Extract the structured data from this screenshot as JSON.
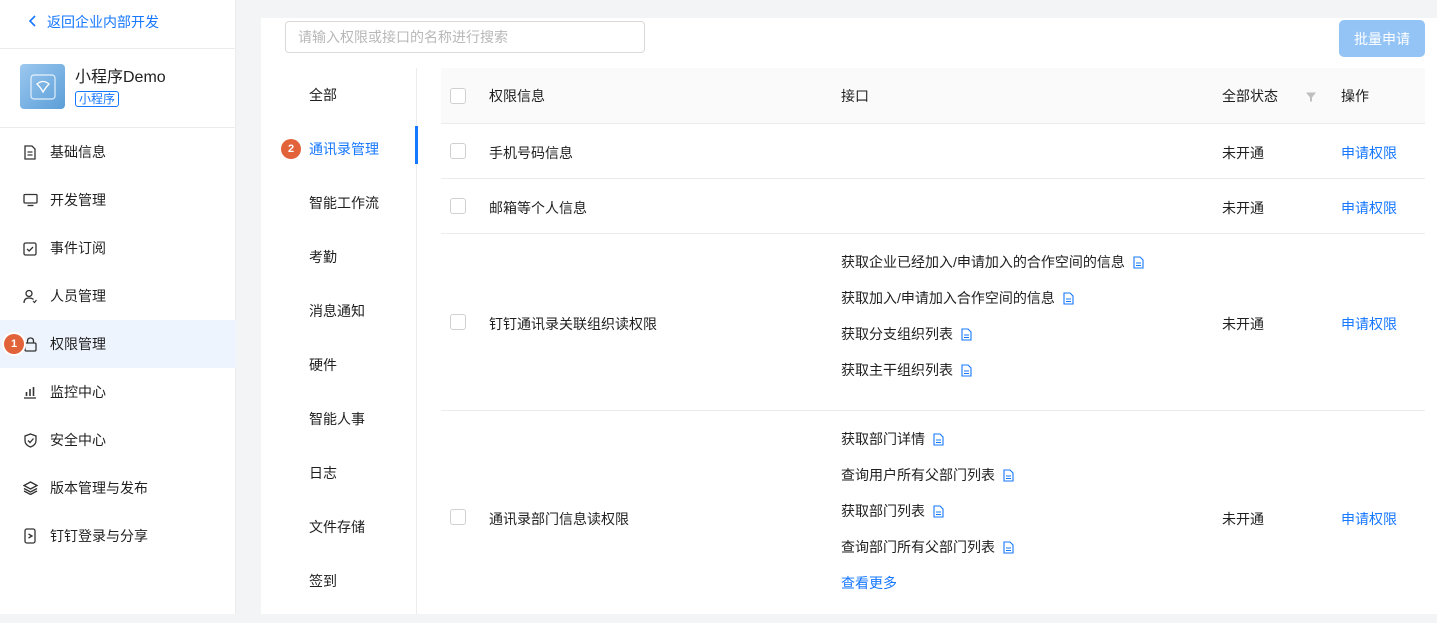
{
  "sidebar": {
    "back_label": "返回企业内部开发",
    "app_name": "小程序Demo",
    "app_tag": "小程序",
    "items": [
      {
        "label": "基础信息",
        "icon": "document-icon"
      },
      {
        "label": "开发管理",
        "icon": "monitor-icon"
      },
      {
        "label": "事件订阅",
        "icon": "calendar-check-icon"
      },
      {
        "label": "人员管理",
        "icon": "user-icon"
      },
      {
        "label": "权限管理",
        "icon": "lock-icon",
        "active": true,
        "badge": "1"
      },
      {
        "label": "监控中心",
        "icon": "bar-chart-icon"
      },
      {
        "label": "安全中心",
        "icon": "shield-icon"
      },
      {
        "label": "版本管理与发布",
        "icon": "layers-icon"
      },
      {
        "label": "钉钉登录与分享",
        "icon": "phone-share-icon"
      }
    ]
  },
  "toolbar": {
    "search_placeholder": "请输入权限或接口的名称进行搜索",
    "batch_label": "批量申请"
  },
  "categories": {
    "active_badge": "2",
    "items": [
      "全部",
      "通讯录管理",
      "智能工作流",
      "考勤",
      "消息通知",
      "硬件",
      "智能人事",
      "日志",
      "文件存储",
      "签到"
    ]
  },
  "table": {
    "headers": {
      "permission": "权限信息",
      "api": "接口",
      "status": "全部状态",
      "action": "操作"
    },
    "rows": [
      {
        "permission": "手机号码信息",
        "apis": [],
        "status": "未开通",
        "action": "申请权限"
      },
      {
        "permission": "邮箱等个人信息",
        "apis": [],
        "status": "未开通",
        "action": "申请权限"
      },
      {
        "permission": "钉钉通讯录关联组织读权限",
        "apis": [
          "获取企业已经加入/申请加入的合作空间的信息",
          "获取加入/申请加入合作空间的信息",
          "获取分支组织列表",
          "获取主干组织列表"
        ],
        "status": "未开通",
        "action": "申请权限"
      },
      {
        "permission": "通讯录部门信息读权限",
        "apis": [
          "获取部门详情",
          "查询用户所有父部门列表",
          "获取部门列表",
          "查询部门所有父部门列表"
        ],
        "more": "查看更多",
        "status": "未开通",
        "action": "申请权限"
      }
    ]
  },
  "colors": {
    "accent": "#1677ff",
    "badge": "#e2623a",
    "active_bg": "#eef4fd"
  }
}
